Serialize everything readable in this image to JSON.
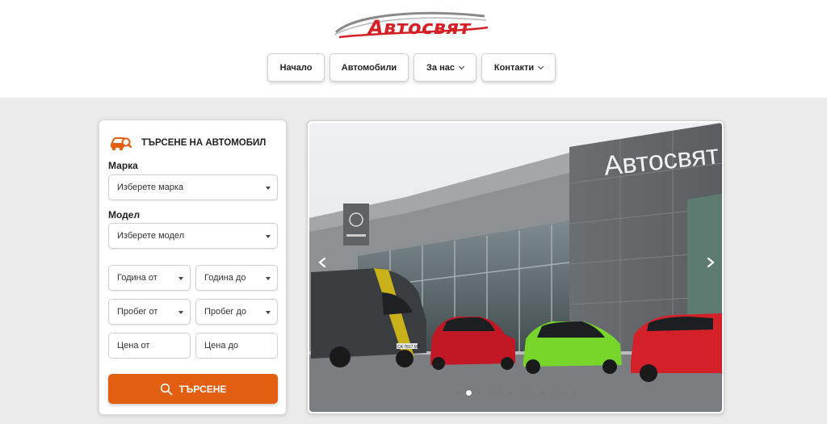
{
  "brand": {
    "logo_text": "Автосвят",
    "accent_color": "#d42127"
  },
  "nav": {
    "items": [
      {
        "label": "Начало",
        "has_dropdown": false
      },
      {
        "label": "Автомобили",
        "has_dropdown": false
      },
      {
        "label": "За нас",
        "has_dropdown": true
      },
      {
        "label": "Контакти",
        "has_dropdown": true
      }
    ]
  },
  "search": {
    "title": "ТЪРСЕНЕ НА АВТОМОБИЛ",
    "icon": "car-search-icon",
    "make_label": "Марка",
    "make_placeholder": "Изберете марка",
    "model_label": "Модел",
    "model_placeholder": "Изберете модел",
    "year_from": "Година от",
    "year_to": "Година до",
    "mileage_from": "Пробег от",
    "mileage_to": "Пробег до",
    "price_from": "Цена от",
    "price_to": "Цена до",
    "button_label": "ТЪРСЕНЕ",
    "button_color": "#e25e10"
  },
  "carousel": {
    "showroom_sign": "Автосвят",
    "slide_count": 12,
    "active_slide": 2,
    "plate_text": "СА 7817 МК"
  }
}
